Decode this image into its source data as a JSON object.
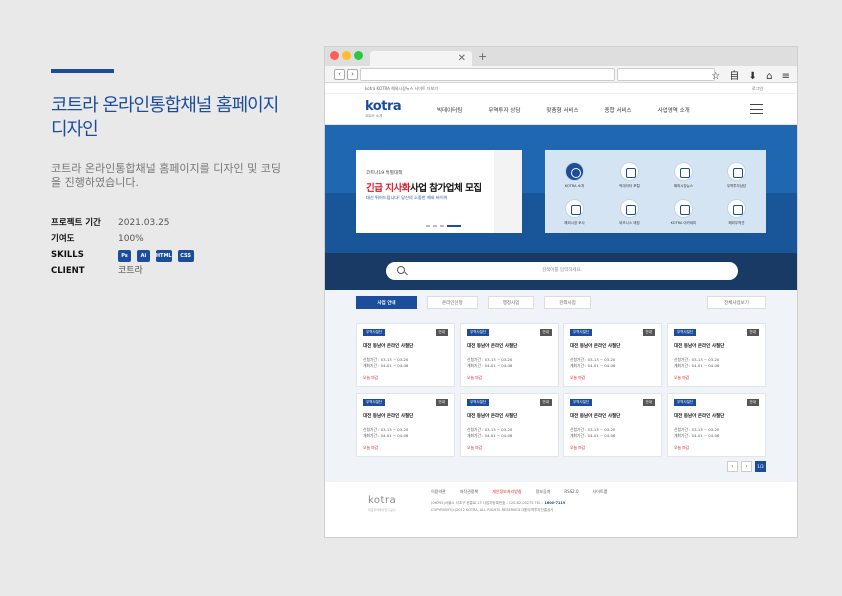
{
  "project": {
    "title": "코트라 온라인통합채널 홈페이지 디자인",
    "description": "코트라 온라인통합채널 홈페이지를 디자인 및 코딩을 진행하였습니다.",
    "info": [
      {
        "label": "프로젝트 기간",
        "value": "2021.03.25"
      },
      {
        "label": "기여도",
        "value": "100%"
      },
      {
        "label": "SKILLS",
        "value": ""
      },
      {
        "label": "CLIENT",
        "value": "코트라"
      }
    ],
    "skills": [
      "Ps",
      "Ai",
      "HTML",
      "CSS"
    ]
  },
  "browser": {
    "dots": [
      "#ff5f57",
      "#febc2e",
      "#28c840"
    ],
    "tab_close": "✕",
    "tab_plus": "+",
    "back": "‹",
    "forward": "›",
    "toolbar_icons": "☆ 自 ⬇ ⌂ ≡"
  },
  "site": {
    "util": {
      "left": "kotra  KOTRA  해외시장뉴스  사이트 더보기",
      "right": "로그인"
    },
    "logo": "kotra",
    "logo_sub": "코트라 소개",
    "menu": [
      "빅데이터팀",
      "무역투자 상담",
      "맞춤형 서비스",
      "종합 서비스",
      "사업영역 소개"
    ],
    "banner": {
      "small": "코트나19 특별대책",
      "title_red": "긴급 지사화",
      "title_rest": "사업 참가업체 모집",
      "sub": "대신 뛰어드립니다! 당신의 소중한 해외 바이어"
    },
    "quick_links": [
      "KOTRA 소개",
      "빅데이터 포털",
      "해외시장뉴스",
      "무역투자상담",
      "해외시장 조사",
      "비즈니스 매칭",
      "KOTRA 아카데미",
      "해외무역관"
    ],
    "search_placeholder": "검색어를 입력하세요.",
    "tabs": [
      "사업 안내",
      "온라인신청",
      "행정사업",
      "관외사업"
    ],
    "all_button": "전체사업보기",
    "cards": [
      {
        "badge": "무역사절단",
        "tag": "안내",
        "title": "대전 동남아 온라인 사절단",
        "d1": "신청기간 : 03-13 ~ 03-20",
        "d2": "개최기간 : 04-01 ~ 04-06",
        "status": "오늘 마감"
      },
      {
        "badge": "무역사절단",
        "tag": "안내",
        "title": "대전 동남아 온라인 사절단",
        "d1": "신청기간 : 03-13 ~ 03-20",
        "d2": "개최기간 : 04-01 ~ 04-06",
        "status": "오늘 마감"
      },
      {
        "badge": "무역사절단",
        "tag": "안내",
        "title": "대전 동남아 온라인 사절단",
        "d1": "신청기간 : 03-13 ~ 03-20",
        "d2": "개최기간 : 04-01 ~ 04-06",
        "status": "오늘 마감"
      },
      {
        "badge": "무역사절단",
        "tag": "안내",
        "title": "대전 동남아 온라인 사절단",
        "d1": "신청기간 : 03-13 ~ 03-20",
        "d2": "개최기간 : 04-01 ~ 04-06",
        "status": "오늘 마감"
      },
      {
        "badge": "무역사절단",
        "tag": "안내",
        "title": "대전 동남아 온라인 사절단",
        "d1": "신청기간 : 03-13 ~ 03-20",
        "d2": "개최기간 : 04-01 ~ 04-06",
        "status": "오늘 마감"
      },
      {
        "badge": "무역사절단",
        "tag": "안내",
        "title": "대전 동남아 온라인 사절단",
        "d1": "신청기간 : 03-13 ~ 03-20",
        "d2": "개최기간 : 04-01 ~ 04-06",
        "status": "오늘 마감"
      },
      {
        "badge": "무역사절단",
        "tag": "안내",
        "title": "대전 동남아 온라인 사절단",
        "d1": "신청기간 : 03-13 ~ 03-20",
        "d2": "개최기간 : 04-01 ~ 04-06",
        "status": "오늘 마감"
      },
      {
        "badge": "무역사절단",
        "tag": "안내",
        "title": "대전 동남아 온라인 사절단",
        "d1": "신청기간 : 03-13 ~ 03-20",
        "d2": "개최기간 : 04-01 ~ 04-06",
        "status": "오늘 마감"
      }
    ],
    "pager": {
      "prev": "‹",
      "next": "›",
      "page": "1/3"
    },
    "footer": {
      "logo": "kotra",
      "logo_sub": "대한무역투자진흥공사",
      "links": [
        "이용약관",
        "저작권정책",
        "개인정보처리방침",
        "정보공개",
        "RSS2.0",
        "사이트맵"
      ],
      "address": "(06792)서울시 서초구 헌릉로 13   사업자등록번호 : 120-82-00275   TEL :",
      "tel": "1600-7119",
      "copyright": "COPYRIGHT(c)2012 KOTRA, ALL RIGHTS RESERVED 대한무역투자진흥공사"
    }
  },
  "colors": {
    "brand": "#1b4d9c",
    "hero": "#1f67b1",
    "search_band": "#1a3a66",
    "alert": "#d6202b"
  }
}
